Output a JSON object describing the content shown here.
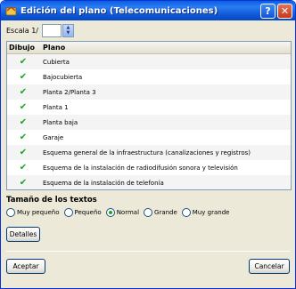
{
  "window": {
    "title": "Edición del plano (Telecomunicaciones)",
    "help_label": "?",
    "close_label": "✕"
  },
  "scale": {
    "label": "Escala 1/",
    "value": ""
  },
  "table": {
    "headers": [
      "Dibujo",
      "Plano"
    ],
    "rows": [
      {
        "checked": true,
        "name": "Cubierta"
      },
      {
        "checked": true,
        "name": "Bajocubierta"
      },
      {
        "checked": true,
        "name": "Planta 2/Planta 3"
      },
      {
        "checked": true,
        "name": "Planta 1"
      },
      {
        "checked": true,
        "name": "Planta baja"
      },
      {
        "checked": true,
        "name": "Garaje"
      },
      {
        "checked": true,
        "name": "Esquema general de la infraestructura (canalizaciones y registros)"
      },
      {
        "checked": true,
        "name": "Esquema de la instalación de radiodifusión sonora y televisión"
      },
      {
        "checked": true,
        "name": "Esquema de la instalación de telefonía"
      }
    ]
  },
  "text_size": {
    "title": "Tamaño de los textos",
    "options": [
      "Muy pequeño",
      "Pequeño",
      "Normal",
      "Grande",
      "Muy grande"
    ],
    "selected": "Normal"
  },
  "buttons": {
    "details": "Detalles",
    "accept": "Aceptar",
    "cancel": "Cancelar"
  },
  "colors": {
    "titlebar": "#0a5ee0",
    "window_bg": "#ece9d8",
    "check": "#21a121"
  }
}
